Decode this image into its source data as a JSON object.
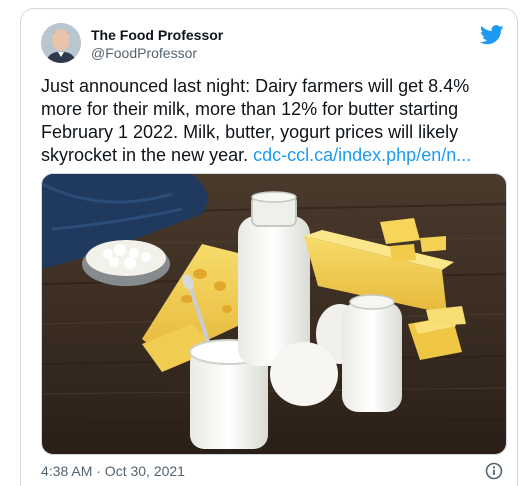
{
  "tweet": {
    "display_name": "The Food Professor",
    "handle": "@FoodProfessor",
    "text": "Just announced last night: Dairy farmers will get 8.4% more for their milk, more than 12% for butter starting February 1 2022. Milk, butter, yogurt prices will likely skyrocket in the new year. ",
    "link_text": "cdc-ccl.ca/index.php/en/n...",
    "timestamp": "4:38 AM · Oct 30, 2021"
  },
  "media": {
    "description_icon": "dairy-products-photo"
  },
  "icons": {
    "logo": "twitter-bird-icon",
    "info": "info-icon"
  },
  "colors": {
    "link": "#1d9bf0",
    "secondary_text": "#536471",
    "brand": "#1d9bf0"
  }
}
